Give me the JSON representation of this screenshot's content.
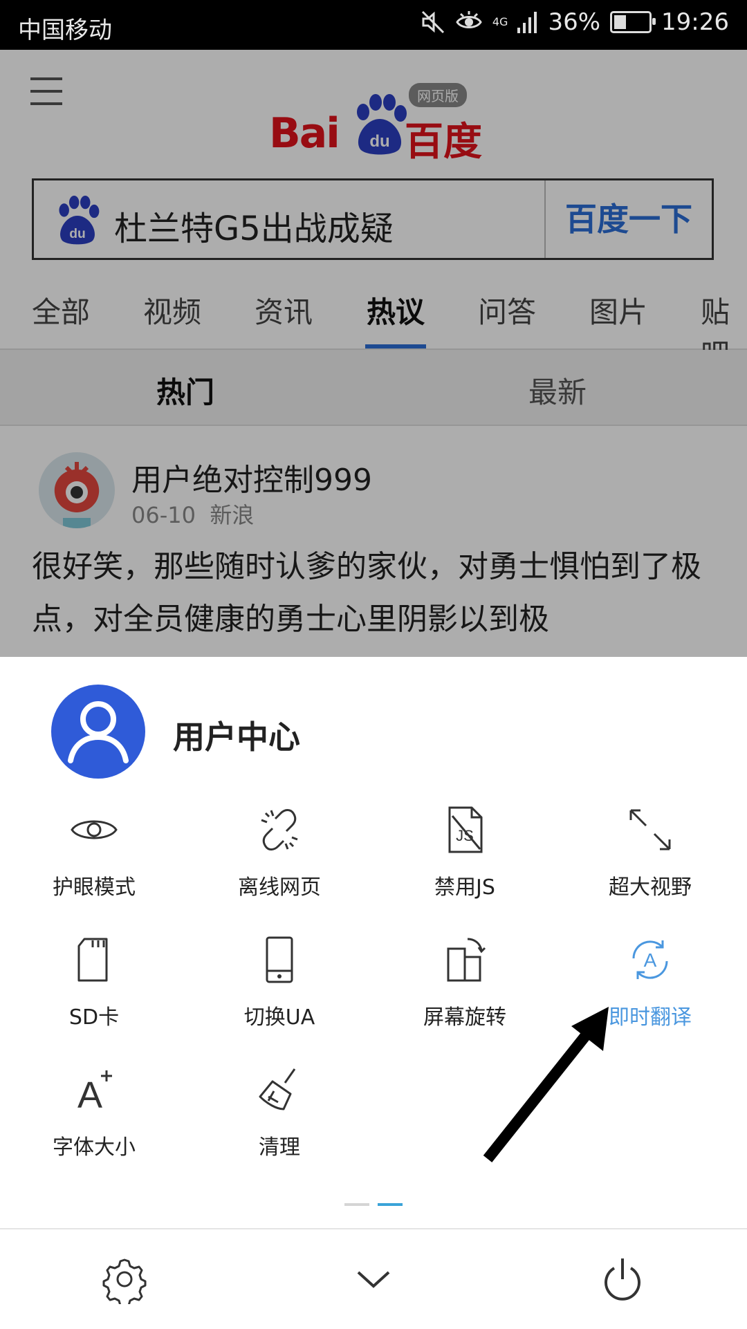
{
  "status_bar": {
    "carrier": "中国移动",
    "network": "4G",
    "battery": "36%",
    "battery_level": 0.36,
    "time": "19:26"
  },
  "header": {
    "logo_latin": "Bai",
    "logo_paw_text": "du",
    "logo_cn": "百度",
    "logo_badge": "网页版"
  },
  "search": {
    "query": "杜兰特G5出战成疑",
    "button_label": "百度一下"
  },
  "tabs": [
    {
      "label": "全部"
    },
    {
      "label": "视频"
    },
    {
      "label": "资讯"
    },
    {
      "label": "热议"
    },
    {
      "label": "问答"
    },
    {
      "label": "图片"
    },
    {
      "label": "贴吧"
    }
  ],
  "active_tab": "热议",
  "subtabs": [
    {
      "label": "热门"
    },
    {
      "label": "最新"
    }
  ],
  "post": {
    "author": "用户绝对控制999",
    "date": "06-10",
    "source": "新浪",
    "text": "很好笑，那些随时认爹的家伙，对勇士惧怕到了极点，对全员健康的勇士心里阴影以到极"
  },
  "sheet": {
    "user_center": "用户中心",
    "items": [
      {
        "label": "护眼模式",
        "icon": "eye-icon"
      },
      {
        "label": "离线网页",
        "icon": "broken-link-icon"
      },
      {
        "label": "禁用JS",
        "icon": "js-file-icon"
      },
      {
        "label": "超大视野",
        "icon": "expand-icon"
      },
      {
        "label": "SD卡",
        "icon": "sd-card-icon"
      },
      {
        "label": "切换UA",
        "icon": "phone-icon"
      },
      {
        "label": "屏幕旋转",
        "icon": "rotate-screen-icon"
      },
      {
        "label": "即时翻译",
        "icon": "translate-icon"
      },
      {
        "label": "字体大小",
        "icon": "font-size-icon"
      },
      {
        "label": "清理",
        "icon": "broom-icon"
      }
    ],
    "pager": {
      "count": 2,
      "active": 2
    }
  },
  "bottom_bar": {
    "settings_icon": "gear-icon",
    "collapse_icon": "chevron-down-icon",
    "exit_icon": "power-icon"
  },
  "colors": {
    "brand_red": "#e0121b",
    "brand_blue": "#2b6dd6",
    "highlight_blue": "#4a97df",
    "avatar_blue": "#2f5bd8"
  }
}
